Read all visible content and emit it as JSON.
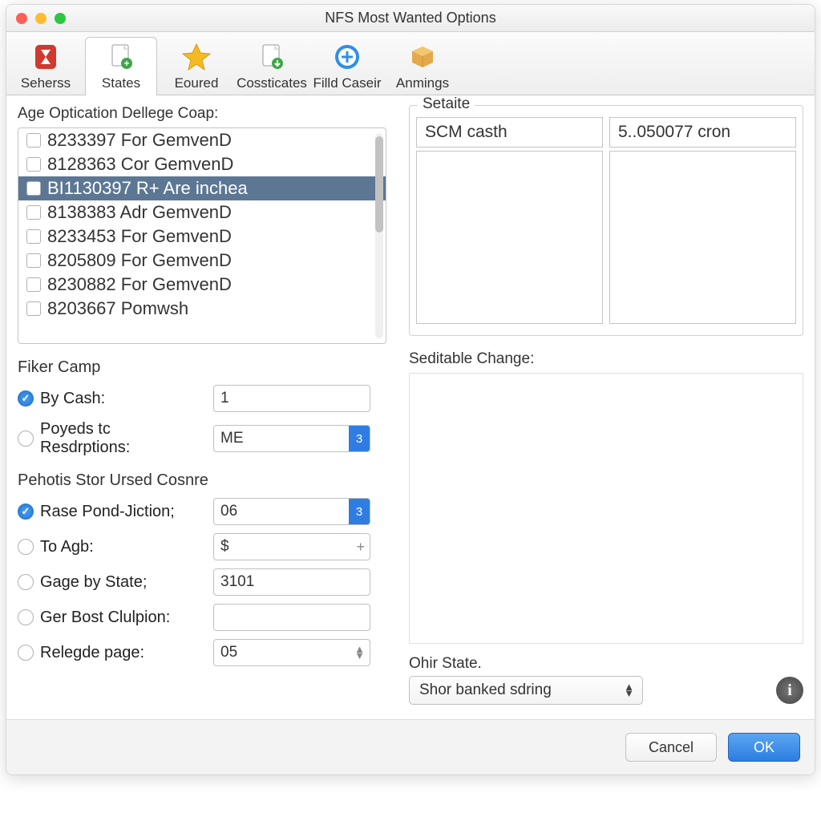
{
  "window": {
    "title": "NFS Most Wanted Options"
  },
  "toolbar": {
    "tabs": [
      {
        "label": "Seherss"
      },
      {
        "label": "States"
      },
      {
        "label": "Eoured"
      },
      {
        "label": "Cossticates"
      },
      {
        "label": "Filld Caseir"
      },
      {
        "label": "Anmings"
      }
    ]
  },
  "left": {
    "list_label": "Age Optication Dellege Coap:",
    "items": [
      "8233397 For GemvenD",
      "8128363 Cor GemvenD",
      "BI1130397 R+ Are inchea",
      "8138383 Adr GemvenD",
      "8233453 For GemvenD",
      "8205809 For GemvenD",
      "8230882 For GemvenD",
      "8203667 Pomwsh"
    ],
    "fiker_title": "Fiker Camp",
    "by_cash_label": "By Cash:",
    "by_cash_value": "1",
    "poyeds_label": "Poyeds tc Resdrptions:",
    "poyeds_value": "ME",
    "pehotis_title": "Pehotis Stor Ursed Cosnre",
    "rase_label": "Rase Pond-Jiction;",
    "rase_value": "06",
    "toagb_label": "To Agb:",
    "toagb_value": "$",
    "gage_label": "Gage by State;",
    "gage_value": "3101",
    "ger_label": "Ger Bost Clulpion:",
    "ger_value": "",
    "relegde_label": "Relegde page:",
    "relegde_value": "05"
  },
  "right": {
    "setaite_title": "Setaite",
    "col1": "SCM casth",
    "col2": "5..050077 cron",
    "sed_label": "Seditable Change:",
    "ohir_label": "Ohir State.",
    "ohir_value": "Shor banked sdring"
  },
  "footer": {
    "cancel": "Cancel",
    "ok": "OK"
  }
}
